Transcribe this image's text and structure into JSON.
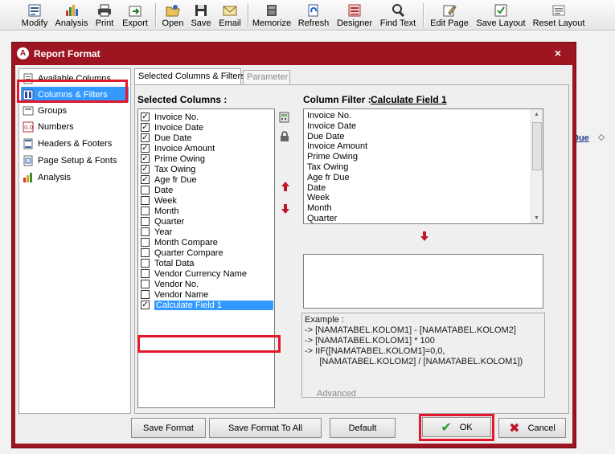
{
  "toolbar": {
    "buttons": [
      {
        "label": "Modify",
        "icon": "modify-icon"
      },
      {
        "label": "Analysis",
        "icon": "analysis-icon"
      },
      {
        "label": "Print",
        "icon": "print-icon"
      },
      {
        "label": "Export",
        "icon": "export-icon"
      },
      {
        "label": "Open",
        "icon": "open-icon"
      },
      {
        "label": "Save",
        "icon": "save-icon"
      },
      {
        "label": "Email",
        "icon": "email-icon"
      },
      {
        "label": "Memorize",
        "icon": "memorize-icon"
      },
      {
        "label": "Refresh",
        "icon": "refresh-icon"
      },
      {
        "label": "Designer",
        "icon": "designer-icon"
      },
      {
        "label": "Find Text",
        "icon": "find-text-icon"
      },
      {
        "label": "Edit Page",
        "icon": "edit-page-icon"
      },
      {
        "label": "Save Layout",
        "icon": "save-layout-icon"
      },
      {
        "label": "Reset Layout",
        "icon": "reset-layout-icon"
      }
    ]
  },
  "background": {
    "due_label": "Due"
  },
  "dialog": {
    "title": "Report Format",
    "close_symbol": "×",
    "nav": [
      {
        "label": "Available Columns",
        "icon": "document-icon"
      },
      {
        "label": "Columns & Filters",
        "icon": "columns-filter-icon"
      },
      {
        "label": "Groups",
        "icon": "groups-icon"
      },
      {
        "label": "Numbers",
        "icon": "numbers-icon"
      },
      {
        "label": "Headers & Footers",
        "icon": "header-footer-icon"
      },
      {
        "label": "Page Setup & Fonts",
        "icon": "page-setup-icon"
      },
      {
        "label": "Analysis",
        "icon": "analysis-chart-icon"
      }
    ],
    "selected_nav": "Columns & Filters",
    "tabs": [
      {
        "label": "Selected Columns & Filters",
        "active": true
      },
      {
        "label": "Parameter",
        "active": false
      }
    ],
    "selected_columns_label": "Selected Columns :",
    "columns": [
      {
        "label": "Invoice No.",
        "checked": true
      },
      {
        "label": "Invoice Date",
        "checked": true
      },
      {
        "label": "Due Date",
        "checked": true
      },
      {
        "label": "Invoice Amount",
        "checked": true
      },
      {
        "label": "Prime Owing",
        "checked": true
      },
      {
        "label": "Tax Owing",
        "checked": true
      },
      {
        "label": "Age fr Due",
        "checked": true
      },
      {
        "label": "Date",
        "checked": false
      },
      {
        "label": "Week",
        "checked": false
      },
      {
        "label": "Month",
        "checked": false
      },
      {
        "label": "Quarter",
        "checked": false
      },
      {
        "label": "Year",
        "checked": false
      },
      {
        "label": "Month Compare",
        "checked": false
      },
      {
        "label": "Quarter Compare",
        "checked": false
      },
      {
        "label": "Total Data",
        "checked": false
      },
      {
        "label": "Vendor Currency Name",
        "checked": false
      },
      {
        "label": "Vendor No.",
        "checked": false
      },
      {
        "label": "Vendor Name",
        "checked": false
      },
      {
        "label": "Calculate Field 1",
        "checked": true,
        "selected": true
      }
    ],
    "column_filter_label": "Column Filter :",
    "column_filter_value": "Calculate Field 1",
    "filter_fields": [
      "Invoice No.",
      "Invoice Date",
      "Due Date",
      "Invoice Amount",
      "Prime Owing",
      "Tax Owing",
      "Age fr Due",
      "Date",
      "Week",
      "Month",
      "Quarter"
    ],
    "example_title": "Example :",
    "example_lines": [
      "->  [NAMATABEL.KOLOM1] - [NAMATABEL.KOLOM2]",
      "->  [NAMATABEL.KOLOM1] * 100",
      "->  IIF([NAMATABEL.KOLOM1]=0,0,",
      "      [NAMATABEL.KOLOM2] / [NAMATABEL.KOLOM1])"
    ],
    "advanced_label": "Advanced",
    "buttons": {
      "save_format": "Save Format",
      "save_format_all": "Save Format To All",
      "default": "Default",
      "ok": "OK",
      "cancel": "Cancel"
    }
  },
  "colors": {
    "dialog_frame": "#9e1522",
    "highlight": "#e3182d",
    "selection": "#3399ff",
    "arrow_red": "#c0172b",
    "ok_check": "#2a9a2a",
    "cancel_x": "#c0172b"
  }
}
